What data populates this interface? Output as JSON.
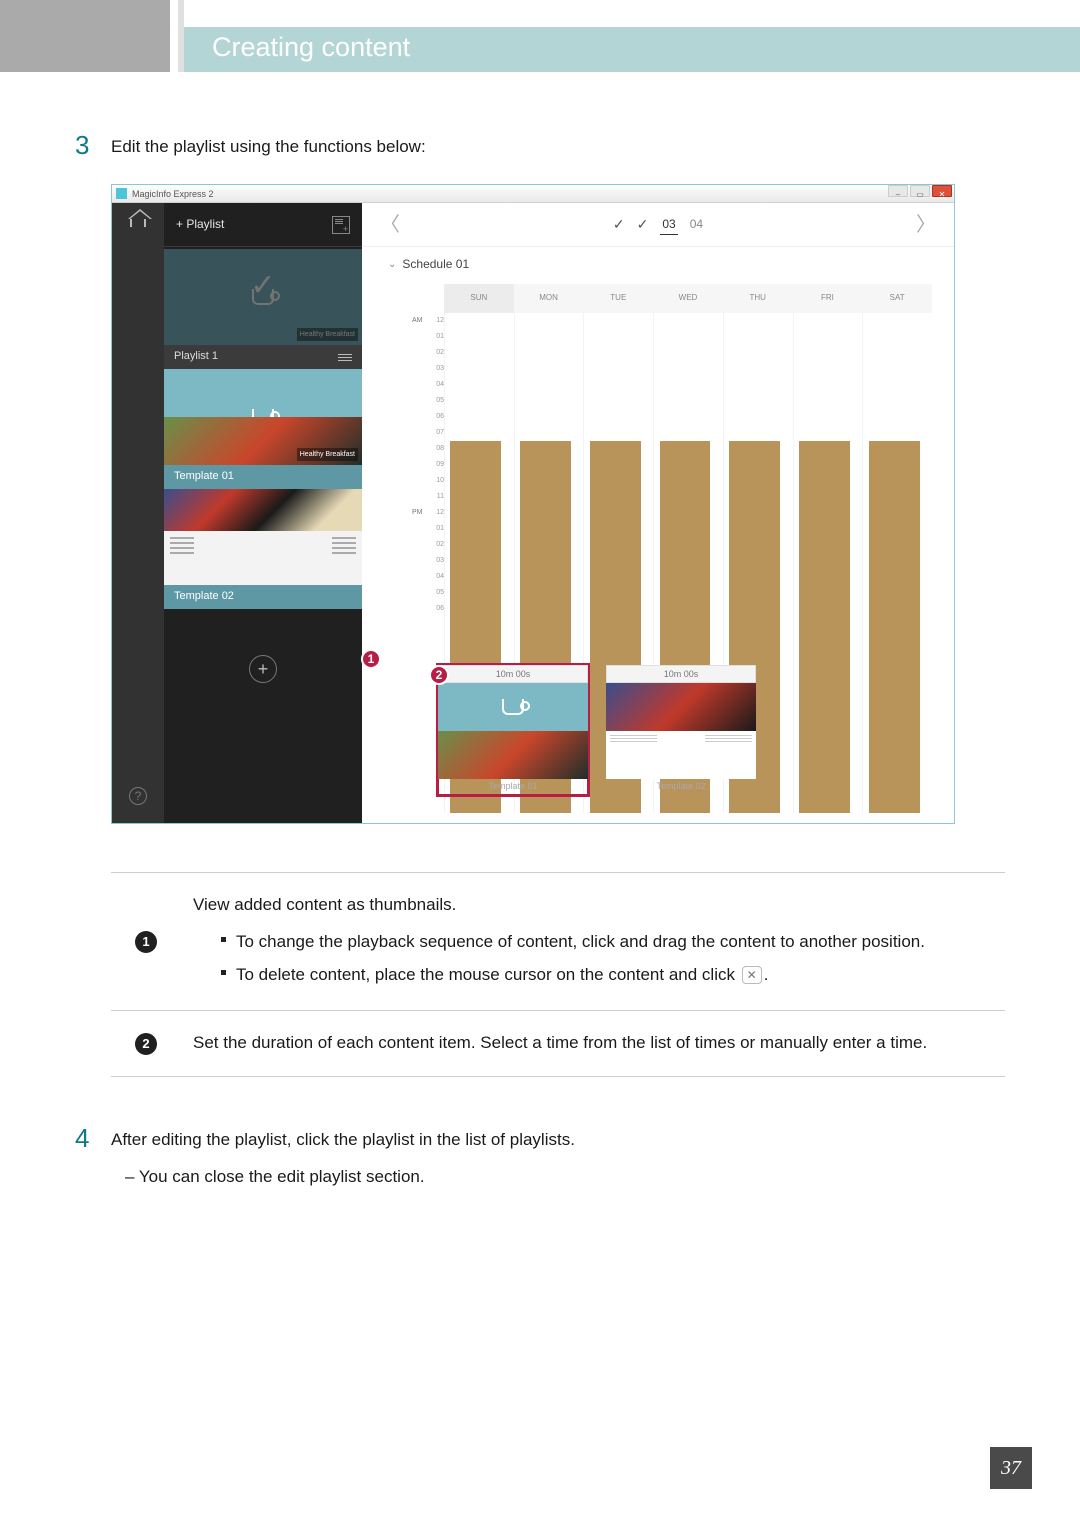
{
  "chapter": "Creating content",
  "step3": {
    "num": "3",
    "text": "Edit the playlist using the functions below:"
  },
  "app": {
    "title": "MagicInfo Express 2",
    "panelTitle": "+ Playlist",
    "tiles": [
      {
        "label": "Playlist 1",
        "badge": "Healthy Breakfast"
      },
      {
        "label": "Template 01",
        "badge": "Healthy Breakfast"
      },
      {
        "label": "Template 02"
      }
    ],
    "scheduleLabel": "Schedule 01",
    "dates": {
      "d1": "03",
      "d2": "04"
    },
    "days": [
      "SUN",
      "MON",
      "TUE",
      "WED",
      "THU",
      "FRI",
      "SAT"
    ],
    "timesAM": [
      "12",
      "01",
      "02",
      "03",
      "04",
      "05",
      "06",
      "07",
      "08",
      "09",
      "10",
      "11"
    ],
    "timesPM": [
      "12",
      "01",
      "02",
      "03",
      "04",
      "05",
      "06"
    ],
    "am": "AM",
    "pm": "PM",
    "cards": [
      {
        "dur": "10m 00s",
        "cap": "Template 01"
      },
      {
        "dur": "10m 00s",
        "cap": "Template 02"
      }
    ]
  },
  "table": {
    "r1": {
      "head": "View added content as thumbnails.",
      "b1": "To change the playback sequence of content, click and drag the content to another position.",
      "b2a": "To delete content, place the mouse cursor on the content and click ",
      "b2b": "."
    },
    "r2": "Set the duration of each content item. Select a time from the list of times or manually enter a time."
  },
  "step4": {
    "num": "4",
    "text": "After editing the playlist, click the playlist in the list of playlists.",
    "sub": "You can close the edit playlist section."
  },
  "pageNum": "37"
}
